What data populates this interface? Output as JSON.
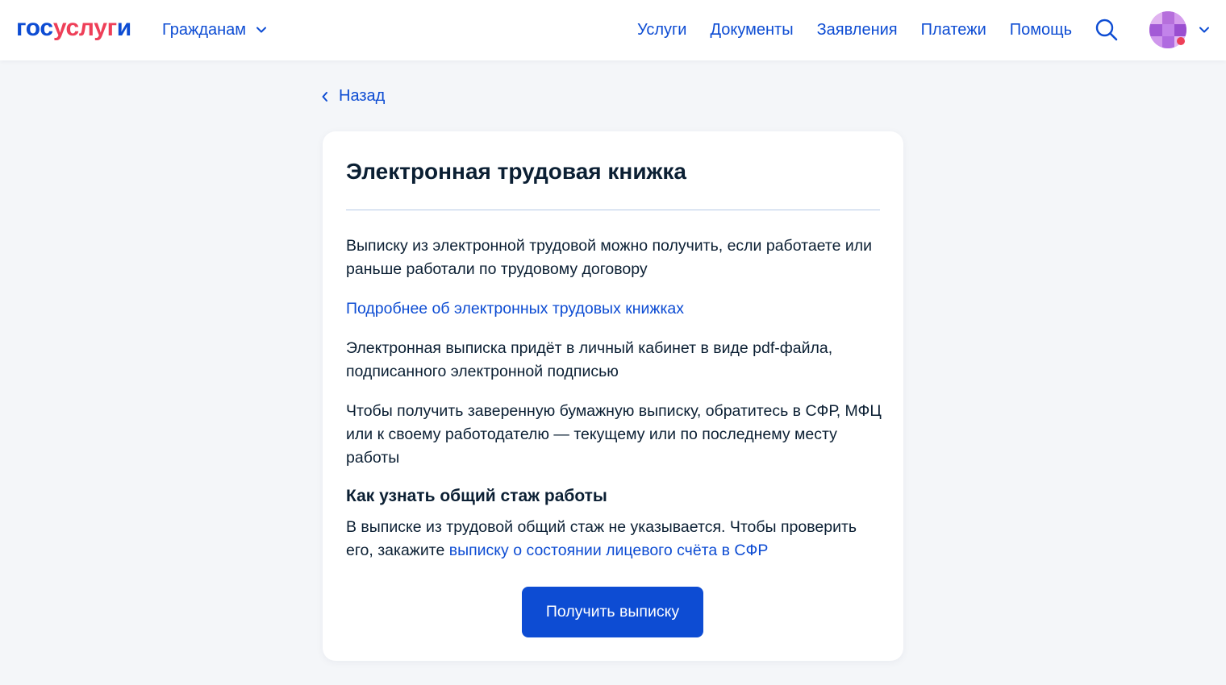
{
  "header": {
    "logo": {
      "part1": "гос",
      "part2": "услуг",
      "part3": "и"
    },
    "audience_label": "Гражданам",
    "nav": [
      "Услуги",
      "Документы",
      "Заявления",
      "Платежи",
      "Помощь"
    ],
    "icons": {
      "search": "search-icon",
      "audience_chevron": "chevron-down-icon",
      "profile_chevron": "chevron-down-icon"
    },
    "colors": {
      "brand_blue": "#0d4cd3",
      "brand_red": "#ee3f58"
    }
  },
  "back_label": "Назад",
  "card": {
    "title": "Электронная трудовая книжка",
    "p1": "Выписку из электронной трудовой можно получить, если работаете или раньше работали по трудовому договору",
    "link_more": "Подробнее об электронных трудовых книжках",
    "p2": "Электронная выписка придёт в личный кабинет в виде pdf-файла, подписанного электронной подписью",
    "p3": "Чтобы получить заверенную бумажную выписку, обратитесь в СФР, МФЦ или к своему работодателю — текущему или по последнему месту работы",
    "subheading": "Как узнать общий стаж работы",
    "p4_text": "В выписке из трудовой общий стаж не указывается. Чтобы проверить его, закажите ",
    "p4_link": "выписку о состоянии лицевого счёта в СФР",
    "button": "Получить выписку"
  }
}
